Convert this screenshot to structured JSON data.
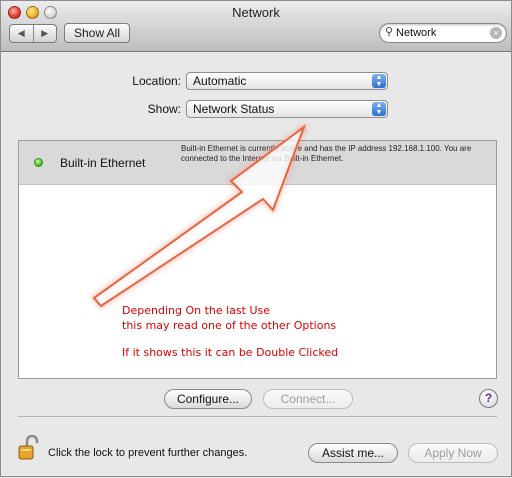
{
  "window": {
    "title": "Network"
  },
  "toolbar": {
    "back_icon": "chevron-left-icon",
    "forward_icon": "chevron-right-icon",
    "show_all_label": "Show All",
    "search_value": "Network"
  },
  "location": {
    "label": "Location:",
    "value": "Automatic"
  },
  "show": {
    "label": "Show:",
    "value": "Network Status"
  },
  "status_list": {
    "items": [
      {
        "name": "Built-in Ethernet",
        "status_color": "#53c226",
        "description": "Built-in Ethernet is currently active and has the IP address 192.168.1.100. You are connected to the Internet via Built-in Ethernet."
      }
    ]
  },
  "annotation": {
    "color": "#e00000",
    "line1": "Depending On the last Use",
    "line2": "this may read one of the other Options",
    "line3": "If it shows this it can be Double Clicked"
  },
  "buttons": {
    "configure": "Configure...",
    "connect": "Connect...",
    "help": "?",
    "assist": "Assist me...",
    "apply": "Apply Now"
  },
  "lock": {
    "message": "Click the lock to prevent further changes."
  }
}
